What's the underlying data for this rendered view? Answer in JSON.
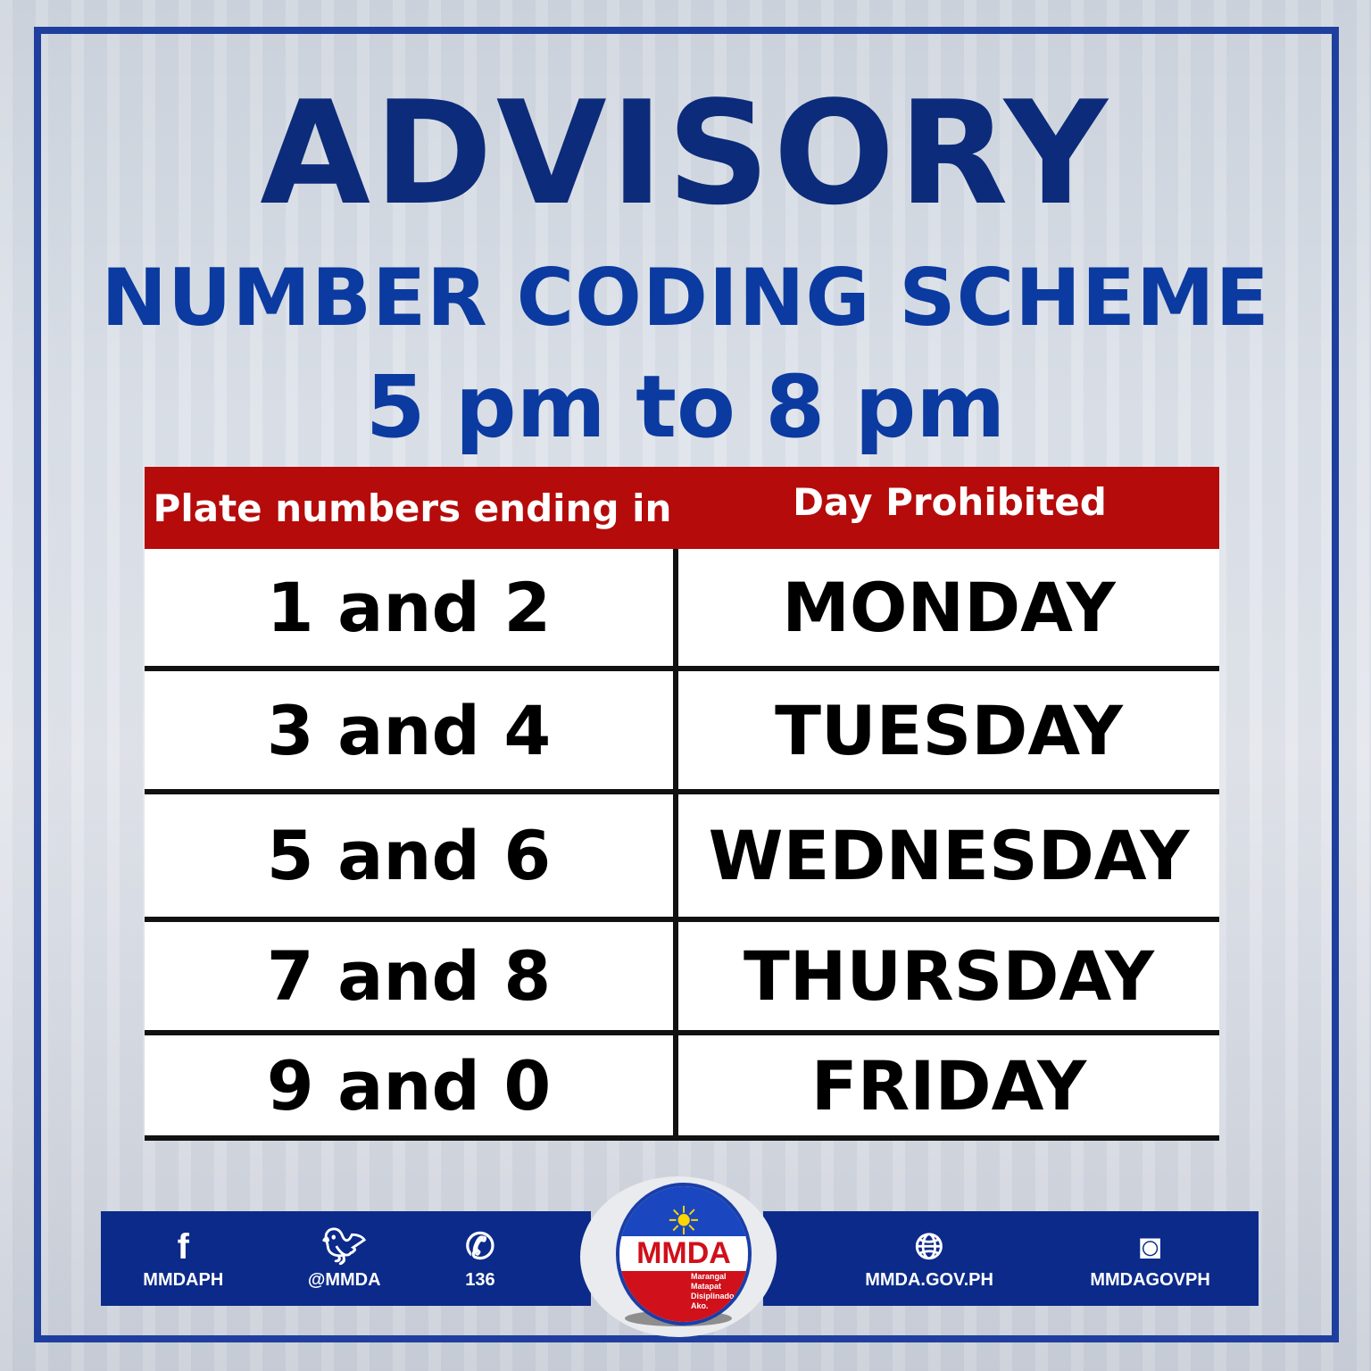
{
  "title": "ADVISORY",
  "subtitle": "NUMBER CODING SCHEME",
  "hours": "5 pm to 8 pm",
  "table": {
    "headers": [
      "Plate numbers ending in",
      "Day Prohibited"
    ],
    "rows": [
      {
        "plates": "1 and 2",
        "day": "MONDAY"
      },
      {
        "plates": "3 and 4",
        "day": "TUESDAY"
      },
      {
        "plates": "5 and 6",
        "day": "WEDNESDAY"
      },
      {
        "plates": "7 and 8",
        "day": "THURSDAY"
      },
      {
        "plates": "9 and 0",
        "day": "FRIDAY"
      }
    ]
  },
  "footer": {
    "facebook": "MMDAPH",
    "twitter": "@MMDA",
    "hotline": "136",
    "website": "MMDA.GOV.PH",
    "instagram": "MMDAGOVPH"
  },
  "logo": {
    "name": "MMDA",
    "motto": "Marangal Matapat Disiplinado Ako."
  },
  "colors": {
    "navy": "#0c2b7a",
    "red": "#b50b0b",
    "frame": "#1f3f9e"
  }
}
